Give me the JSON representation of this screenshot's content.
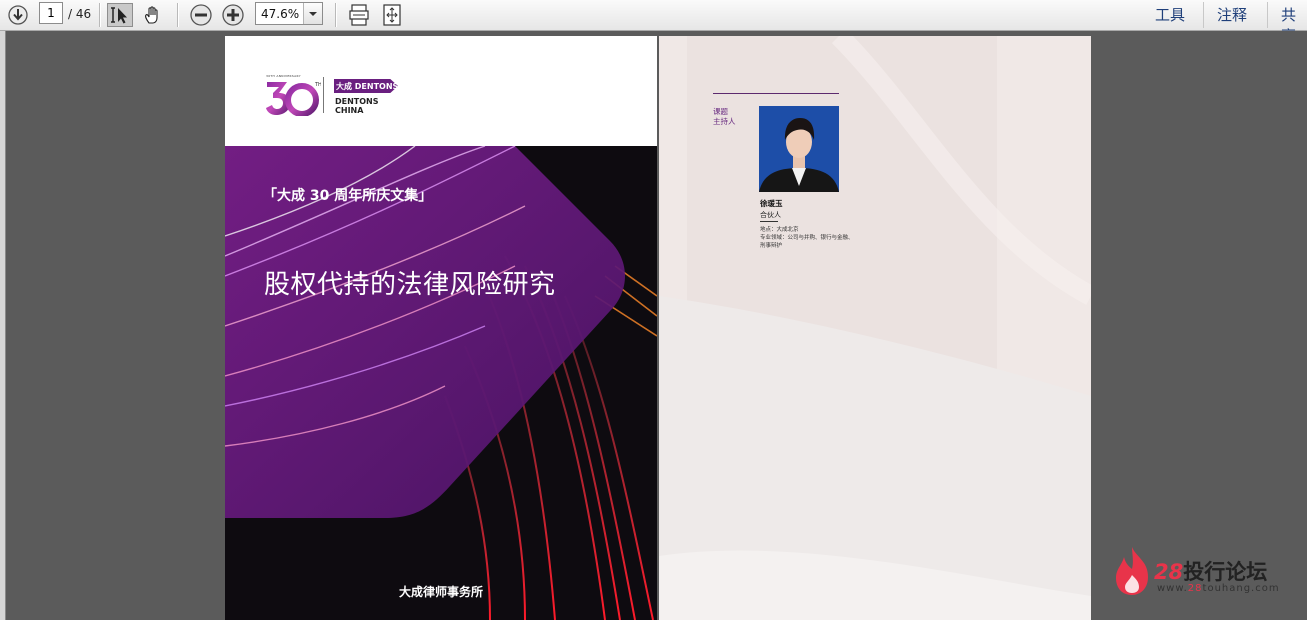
{
  "toolbar": {
    "page_current": "1",
    "page_total": "/ 46",
    "zoom": "47.6%",
    "menu": [
      "工具",
      "注释",
      "共享"
    ]
  },
  "cover": {
    "series": "「大成 30 周年所庆文集」",
    "title": "股权代持的法律风险研究",
    "footer": "大成律师事务所",
    "logo": {
      "anniversary_small": "30TH ANNIVERSARY",
      "badge": "大成 DENTONS",
      "name_line1": "DENTONS",
      "name_line2": "CHINA"
    },
    "colors": {
      "purple": "#6a1f80",
      "dark": "#0c0c0c"
    }
  },
  "page2": {
    "label_topic": "课题",
    "label_host": "主持人",
    "name": "徐瑗玉",
    "role": "合伙人",
    "detail_1": "地点：大成北京",
    "detail_2": "专业领域：公司与并购、银行与金融、",
    "detail_3": "刑事辩护"
  },
  "watermark": {
    "num": "28",
    "text": "投行论坛",
    "url_prefix": "www.",
    "url_highlight": "28",
    "url_suffix": "touhang.com"
  }
}
